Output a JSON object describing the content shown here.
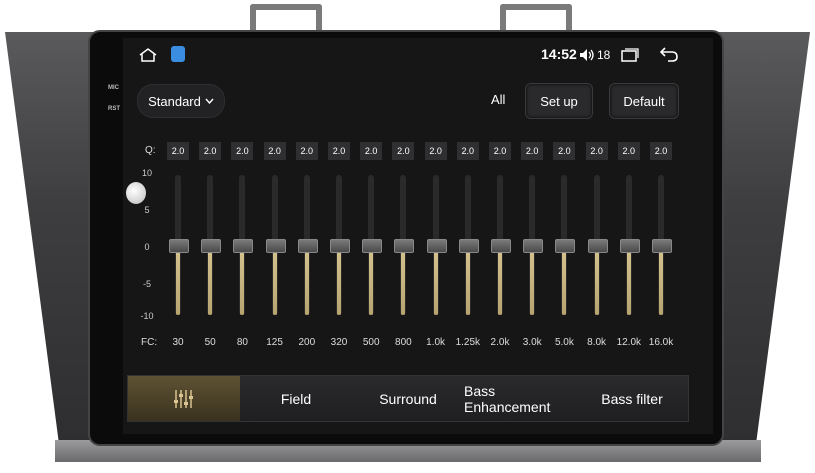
{
  "side": {
    "mic_label": "MIC",
    "rst_label": "RST"
  },
  "status": {
    "time": "14:52",
    "volume": "18"
  },
  "controls": {
    "preset": "Standard",
    "all_label": "All",
    "setup_label": "Set up",
    "default_label": "Default"
  },
  "eq": {
    "q_label": "Q:",
    "fc_label": "FC:",
    "y_ticks": [
      "10",
      "5",
      "0",
      "-5",
      "-10"
    ],
    "bands": [
      {
        "q": "2.0",
        "fc": "30",
        "gain": 0
      },
      {
        "q": "2.0",
        "fc": "50",
        "gain": 0
      },
      {
        "q": "2.0",
        "fc": "80",
        "gain": 0
      },
      {
        "q": "2.0",
        "fc": "125",
        "gain": 0
      },
      {
        "q": "2.0",
        "fc": "200",
        "gain": 0
      },
      {
        "q": "2.0",
        "fc": "320",
        "gain": 0
      },
      {
        "q": "2.0",
        "fc": "500",
        "gain": 0
      },
      {
        "q": "2.0",
        "fc": "800",
        "gain": 0
      },
      {
        "q": "2.0",
        "fc": "1.0k",
        "gain": 0
      },
      {
        "q": "2.0",
        "fc": "1.25k",
        "gain": 0
      },
      {
        "q": "2.0",
        "fc": "2.0k",
        "gain": 0
      },
      {
        "q": "2.0",
        "fc": "3.0k",
        "gain": 0
      },
      {
        "q": "2.0",
        "fc": "5.0k",
        "gain": 0
      },
      {
        "q": "2.0",
        "fc": "8.0k",
        "gain": 0
      },
      {
        "q": "2.0",
        "fc": "12.0k",
        "gain": 0
      },
      {
        "q": "2.0",
        "fc": "16.0k",
        "gain": 0
      }
    ]
  },
  "tabs": [
    "",
    "Field",
    "Surround",
    "Bass Enhancement",
    "Bass filter"
  ],
  "icons": {
    "home": "home-icon",
    "app": "app-icon",
    "volume": "volume-icon",
    "recent": "recent-apps-icon",
    "back": "back-icon",
    "eq_tab": "equalizer-icon"
  }
}
